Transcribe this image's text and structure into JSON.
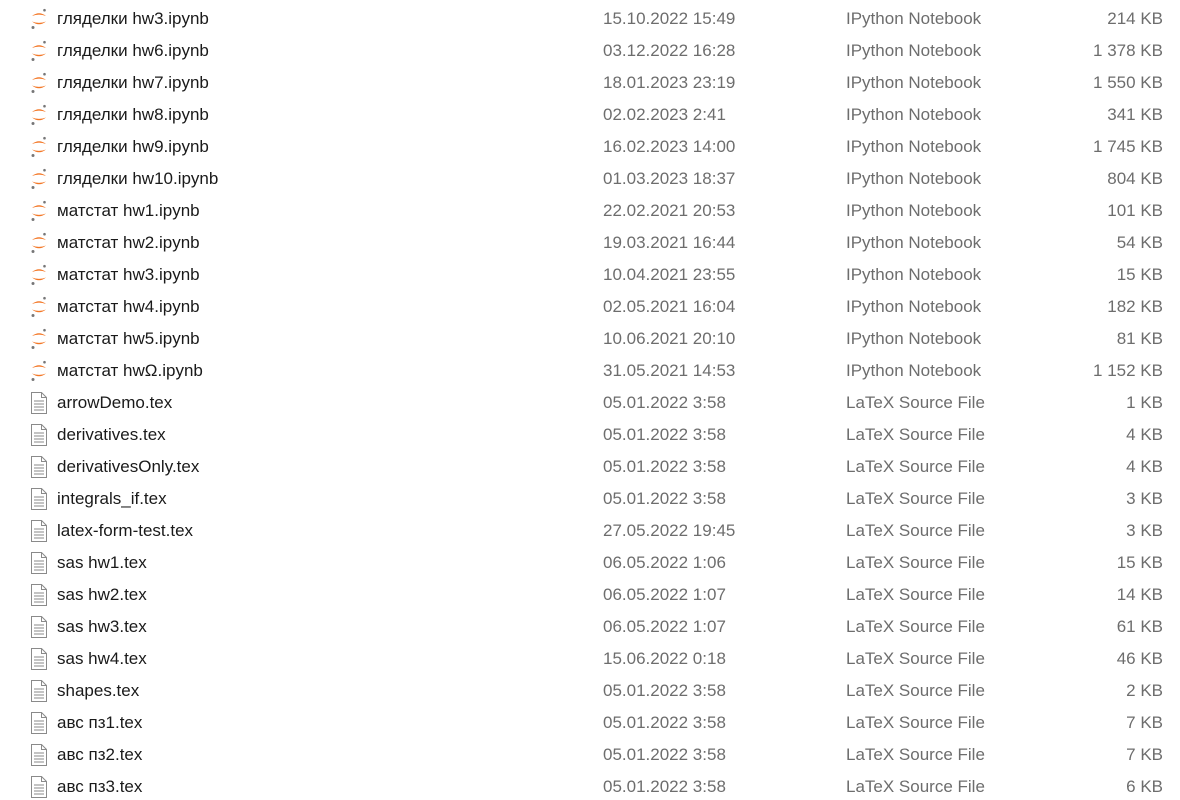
{
  "colors": {
    "notebook_icon": "#f37726",
    "text_primary": "#1a1a1a",
    "text_secondary": "#6d6d6d",
    "doc_icon_stroke": "#8a8a8a"
  },
  "files": [
    {
      "name": "гляделки hw3.ipynb",
      "date": "15.10.2022 15:49",
      "type": "IPython Notebook",
      "size": "214 KB",
      "icon": "jupyter-notebook-icon"
    },
    {
      "name": "гляделки hw6.ipynb",
      "date": "03.12.2022 16:28",
      "type": "IPython Notebook",
      "size": "1 378 KB",
      "icon": "jupyter-notebook-icon"
    },
    {
      "name": "гляделки hw7.ipynb",
      "date": "18.01.2023 23:19",
      "type": "IPython Notebook",
      "size": "1 550 KB",
      "icon": "jupyter-notebook-icon"
    },
    {
      "name": "гляделки hw8.ipynb",
      "date": "02.02.2023 2:41",
      "type": "IPython Notebook",
      "size": "341 KB",
      "icon": "jupyter-notebook-icon"
    },
    {
      "name": "гляделки hw9.ipynb",
      "date": "16.02.2023 14:00",
      "type": "IPython Notebook",
      "size": "1 745 KB",
      "icon": "jupyter-notebook-icon"
    },
    {
      "name": "гляделки hw10.ipynb",
      "date": "01.03.2023 18:37",
      "type": "IPython Notebook",
      "size": "804 KB",
      "icon": "jupyter-notebook-icon"
    },
    {
      "name": "матстат hw1.ipynb",
      "date": "22.02.2021 20:53",
      "type": "IPython Notebook",
      "size": "101 KB",
      "icon": "jupyter-notebook-icon"
    },
    {
      "name": "матстат hw2.ipynb",
      "date": "19.03.2021 16:44",
      "type": "IPython Notebook",
      "size": "54 KB",
      "icon": "jupyter-notebook-icon"
    },
    {
      "name": "матстат hw3.ipynb",
      "date": "10.04.2021 23:55",
      "type": "IPython Notebook",
      "size": "15 KB",
      "icon": "jupyter-notebook-icon"
    },
    {
      "name": "матстат hw4.ipynb",
      "date": "02.05.2021 16:04",
      "type": "IPython Notebook",
      "size": "182 KB",
      "icon": "jupyter-notebook-icon"
    },
    {
      "name": "матстат hw5.ipynb",
      "date": "10.06.2021 20:10",
      "type": "IPython Notebook",
      "size": "81 KB",
      "icon": "jupyter-notebook-icon"
    },
    {
      "name": "матстат hwΩ.ipynb",
      "date": "31.05.2021 14:53",
      "type": "IPython Notebook",
      "size": "1 152 KB",
      "icon": "jupyter-notebook-icon"
    },
    {
      "name": "arrowDemo.tex",
      "date": "05.01.2022 3:58",
      "type": "LaTeX Source File",
      "size": "1 KB",
      "icon": "document-icon"
    },
    {
      "name": "derivatives.tex",
      "date": "05.01.2022 3:58",
      "type": "LaTeX Source File",
      "size": "4 KB",
      "icon": "document-icon"
    },
    {
      "name": "derivativesOnly.tex",
      "date": "05.01.2022 3:58",
      "type": "LaTeX Source File",
      "size": "4 KB",
      "icon": "document-icon"
    },
    {
      "name": "integrals_if.tex",
      "date": "05.01.2022 3:58",
      "type": "LaTeX Source File",
      "size": "3 KB",
      "icon": "document-icon"
    },
    {
      "name": "latex-form-test.tex",
      "date": "27.05.2022 19:45",
      "type": "LaTeX Source File",
      "size": "3 KB",
      "icon": "document-icon"
    },
    {
      "name": "sas hw1.tex",
      "date": "06.05.2022 1:06",
      "type": "LaTeX Source File",
      "size": "15 KB",
      "icon": "document-icon"
    },
    {
      "name": "sas hw2.tex",
      "date": "06.05.2022 1:07",
      "type": "LaTeX Source File",
      "size": "14 KB",
      "icon": "document-icon"
    },
    {
      "name": "sas hw3.tex",
      "date": "06.05.2022 1:07",
      "type": "LaTeX Source File",
      "size": "61 KB",
      "icon": "document-icon"
    },
    {
      "name": "sas hw4.tex",
      "date": "15.06.2022 0:18",
      "type": "LaTeX Source File",
      "size": "46 KB",
      "icon": "document-icon"
    },
    {
      "name": "shapes.tex",
      "date": "05.01.2022 3:58",
      "type": "LaTeX Source File",
      "size": "2 KB",
      "icon": "document-icon"
    },
    {
      "name": "авс пз1.tex",
      "date": "05.01.2022 3:58",
      "type": "LaTeX Source File",
      "size": "7 KB",
      "icon": "document-icon"
    },
    {
      "name": "авс пз2.tex",
      "date": "05.01.2022 3:58",
      "type": "LaTeX Source File",
      "size": "7 KB",
      "icon": "document-icon"
    },
    {
      "name": "авс пз3.tex",
      "date": "05.01.2022 3:58",
      "type": "LaTeX Source File",
      "size": "6 KB",
      "icon": "document-icon"
    }
  ]
}
